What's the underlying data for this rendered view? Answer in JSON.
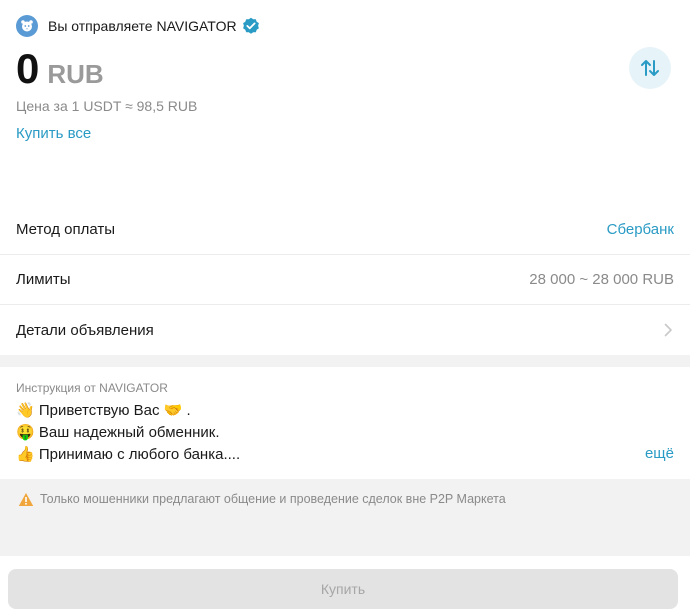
{
  "header": {
    "seller_text": "Вы отправляете NAVIGATOR",
    "avatar_icon": "tiger-avatar-icon",
    "verified_icon": "verified-badge-icon"
  },
  "amount": {
    "value": "0",
    "currency": "RUB"
  },
  "price_line": "Цена за 1 USDT ≈ 98,5 RUB",
  "buy_all_label": "Купить все",
  "details": {
    "payment_method": {
      "label": "Метод оплаты",
      "value": "Сбербанк"
    },
    "limits": {
      "label": "Лимиты",
      "value": "28 000 ~ 28 000 RUB"
    },
    "ad_details": {
      "label": "Детали объявления"
    }
  },
  "instructions": {
    "title": "Инструкция от NAVIGATOR",
    "lines": [
      "👋 Приветствую Вас 🤝 .",
      "🤑 Ваш надежный обменник.",
      "👍 Принимаю с любого банка...."
    ],
    "more_label": "ещё"
  },
  "warning": "Только мошенники предлагают общение и проведение сделок вне P2P Маркета",
  "footer": {
    "buy_label": "Купить"
  },
  "colors": {
    "accent": "#2a9bc4",
    "muted": "#8a8a8a",
    "warning": "#f0a63c"
  }
}
